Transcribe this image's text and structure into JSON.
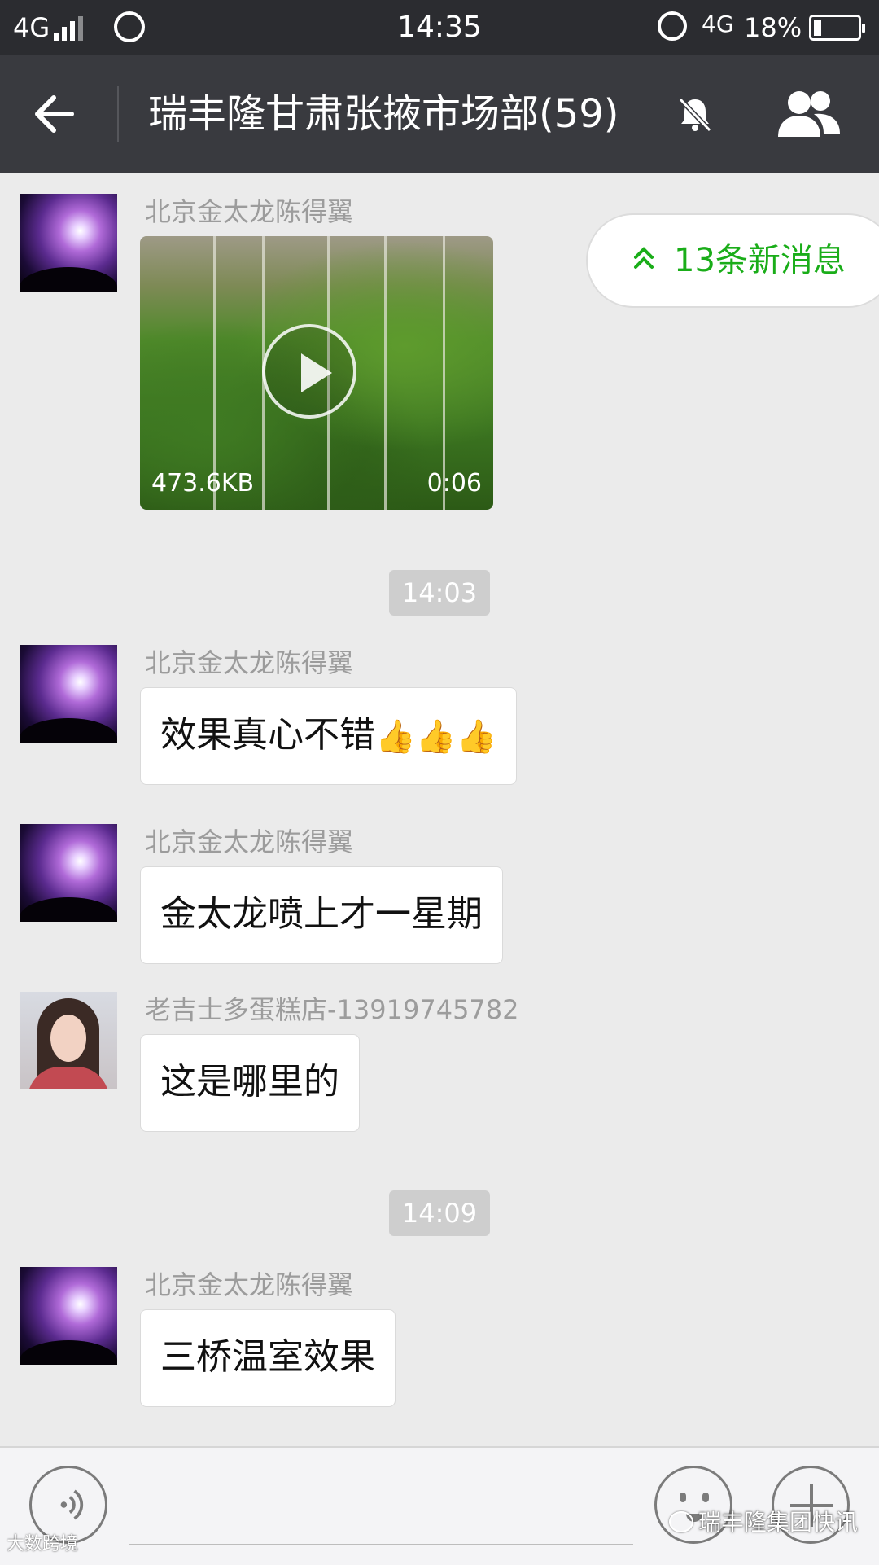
{
  "status_bar": {
    "network_left": "4G",
    "time": "14:35",
    "network_right": "4G",
    "battery": "18%",
    "battery_level": 0.18
  },
  "header": {
    "title": "瑞丰隆甘肃张掖市场部(59)"
  },
  "new_messages": {
    "label": "13条新消息"
  },
  "messages": [
    {
      "sender": "北京金太龙陈得翼",
      "type": "video",
      "size": "473.6KB",
      "duration": "0:06"
    },
    {
      "type": "time",
      "text": "14:03"
    },
    {
      "sender": "北京金太龙陈得翼",
      "type": "text",
      "text": "效果真心不错",
      "emoji": "👍👍👍"
    },
    {
      "sender": "北京金太龙陈得翼",
      "type": "text",
      "text": "金太龙喷上才一星期"
    },
    {
      "sender": "老吉士多蛋糕店-13919745782",
      "type": "text",
      "text": "这是哪里的"
    },
    {
      "type": "time",
      "text": "14:09"
    },
    {
      "sender": "北京金太龙陈得翼",
      "type": "text",
      "text": "三桥温室效果"
    }
  ],
  "watermarks": {
    "brand": "瑞丰隆集团快讯",
    "corner": "大数跨境"
  },
  "colors": {
    "title_bar": "#393a3f",
    "status_bar": "#2b2c30",
    "chat_bg": "#ebebeb",
    "accent_green": "#1aad19"
  }
}
